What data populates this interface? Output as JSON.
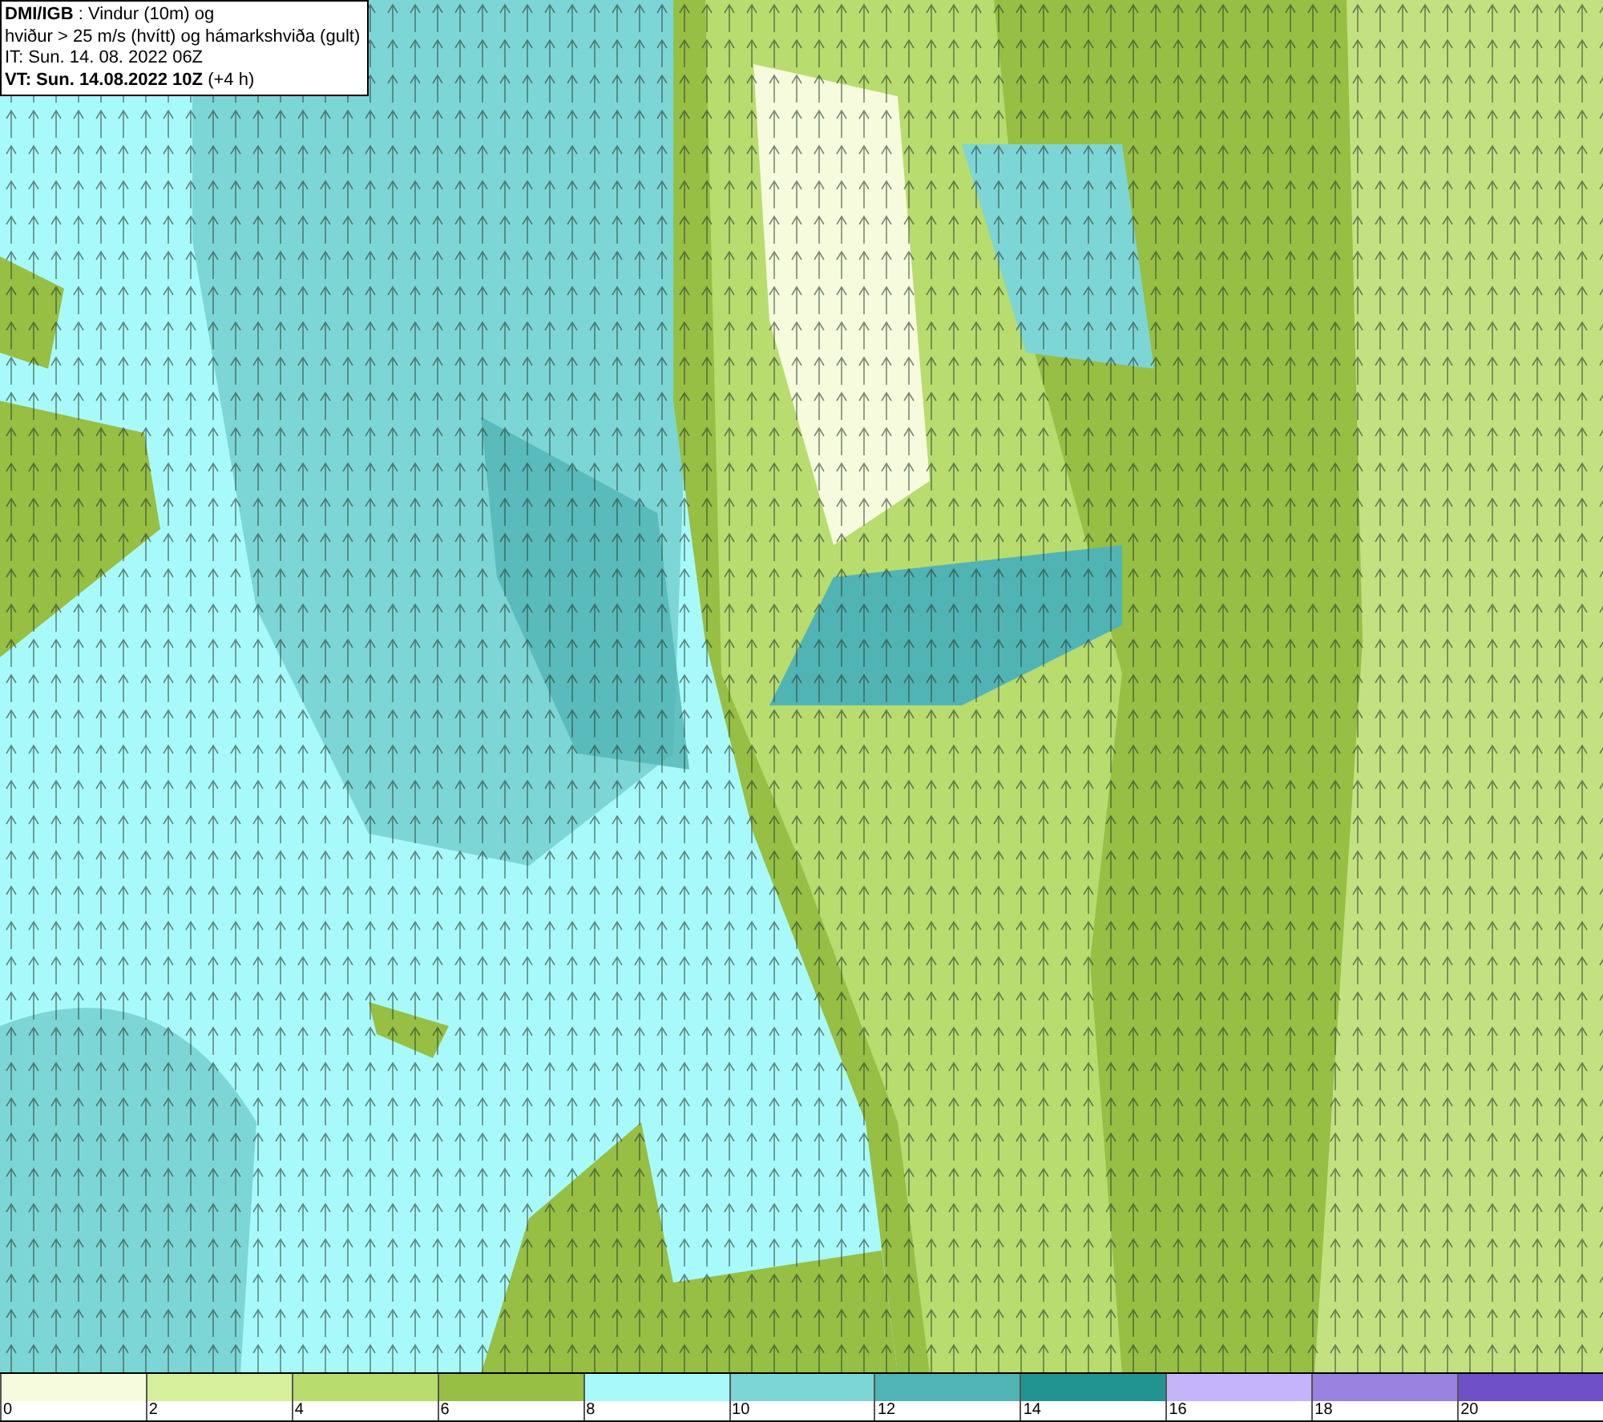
{
  "header": {
    "lines": [
      "**DMI/IGB** : Vindur (10m) og",
      "hviður > 25 m/s (hvítt) og hámarkshviða (gult)",
      "IT: Sun. 14. 08. 2022 06Z",
      "**VT: Sun. 14.08.2022 10Z** (+4 h)"
    ]
  },
  "legend": [
    {
      "label": "0",
      "color": "#f5fbdc"
    },
    {
      "label": "2",
      "color": "#d6ef9a"
    },
    {
      "label": "4",
      "color": "#b8dc6e"
    },
    {
      "label": "6",
      "color": "#96bf44"
    },
    {
      "label": "8",
      "color": "#a8fafa"
    },
    {
      "label": "10",
      "color": "#7dd6d6"
    },
    {
      "label": "12",
      "color": "#50b4b4"
    },
    {
      "label": "14",
      "color": "#229490"
    },
    {
      "label": "16",
      "color": "#c4b4fa"
    },
    {
      "label": "18",
      "color": "#9a82e0"
    },
    {
      "label": "20",
      "color": "#7050c8"
    }
  ]
}
